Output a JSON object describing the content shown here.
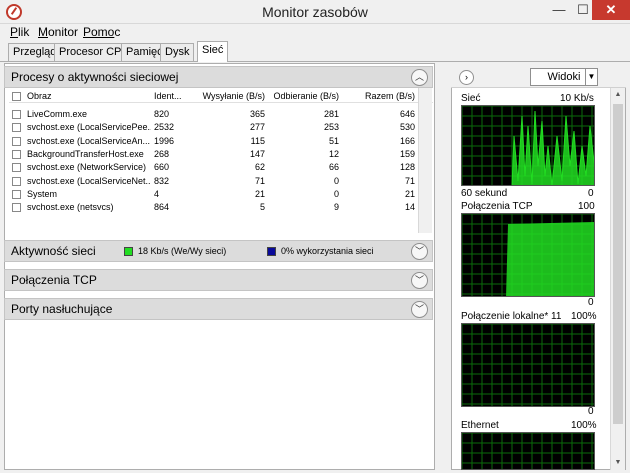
{
  "window": {
    "title": "Monitor zasobów",
    "min_glyph": "—",
    "max_glyph": "☐",
    "close_glyph": "✕"
  },
  "menu": [
    {
      "label": "Plik",
      "underline": "P",
      "rest": "lik"
    },
    {
      "label": "Monitor",
      "underline": "M",
      "rest": "onitor"
    },
    {
      "label": "Pomoc",
      "underline": "Pomo",
      "rest": "c"
    }
  ],
  "tabs": [
    "Przegląd",
    "Procesor CPU",
    "Pamięć",
    "Dysk",
    "Sieć"
  ],
  "active_tab": "Sieć",
  "processes_section": {
    "title": "Procesy o aktywności sieciowej",
    "columns": [
      "Obraz",
      "Ident...",
      "Wysyłanie (B/s)",
      "Odbieranie (B/s)",
      "Razem (B/s)"
    ],
    "rows": [
      {
        "image": "LiveComm.exe",
        "pid": "820",
        "send": "365",
        "recv": "281",
        "total": "646"
      },
      {
        "image": "svchost.exe (LocalServicePee...",
        "pid": "2532",
        "send": "277",
        "recv": "253",
        "total": "530"
      },
      {
        "image": "svchost.exe (LocalServiceAn...",
        "pid": "1996",
        "send": "115",
        "recv": "51",
        "total": "166"
      },
      {
        "image": "BackgroundTransferHost.exe",
        "pid": "268",
        "send": "147",
        "recv": "12",
        "total": "159"
      },
      {
        "image": "svchost.exe (NetworkService)",
        "pid": "660",
        "send": "62",
        "recv": "66",
        "total": "128"
      },
      {
        "image": "svchost.exe (LocalServiceNet...",
        "pid": "832",
        "send": "71",
        "recv": "0",
        "total": "71"
      },
      {
        "image": "System",
        "pid": "4",
        "send": "21",
        "recv": "0",
        "total": "21"
      },
      {
        "image": "svchost.exe (netsvcs)",
        "pid": "864",
        "send": "5",
        "recv": "9",
        "total": "14"
      }
    ]
  },
  "network_activity": {
    "title": "Aktywność sieci",
    "legend1": "18 Kb/s (We/Wy sieci)",
    "legend1_color": "#22dd22",
    "legend2": "0% wykorzystania sieci",
    "legend2_color": "#0a0a9a"
  },
  "tcp_section": {
    "title": "Połączenia TCP"
  },
  "ports_section": {
    "title": "Porty nasłuchujące"
  },
  "right": {
    "views_label": "Widoki",
    "graphs": [
      {
        "title": "Sieć",
        "max": "10 Kb/s",
        "footer_left": "60 sekund",
        "footer_right": "0"
      },
      {
        "title": "Połączenia TCP",
        "max": "100",
        "footer_left": "",
        "footer_right": "0"
      },
      {
        "title": "Połączenie lokalne* 11",
        "max": "100%",
        "footer_left": "",
        "footer_right": "0"
      },
      {
        "title": "Ethernet",
        "max": "100%",
        "footer_left": "",
        "footer_right": ""
      }
    ]
  },
  "colors": {
    "graph_bg": "#000000",
    "grid": "#0b6b0b",
    "line": "#22dd22"
  }
}
